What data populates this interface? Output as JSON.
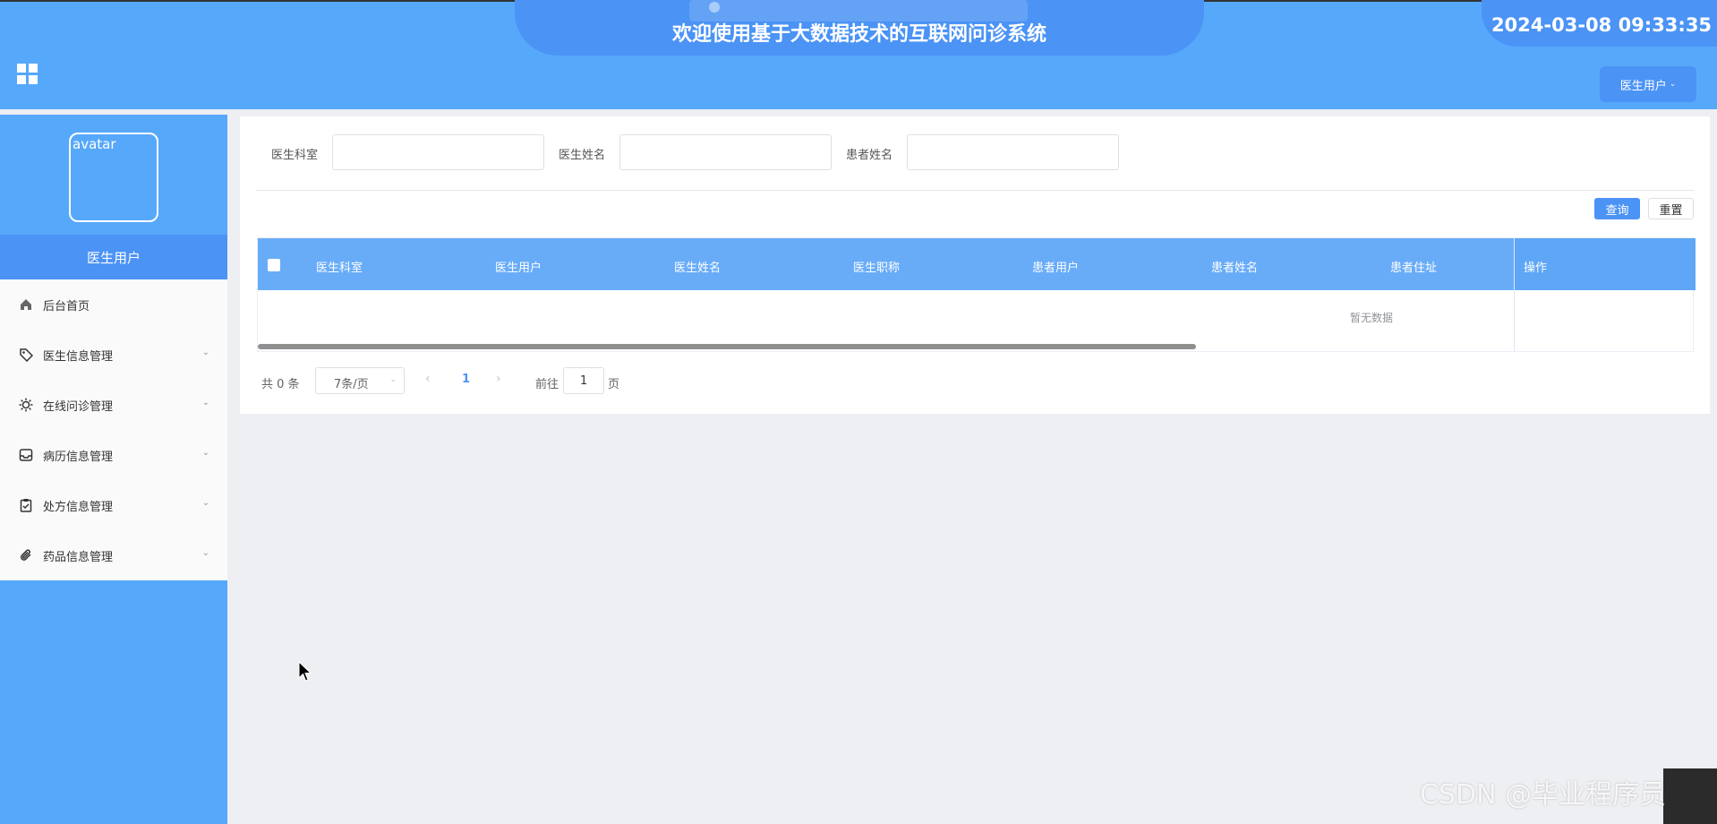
{
  "header": {
    "title": "欢迎使用基于大数据技术的互联网问诊系统",
    "datetime": "2024-03-08 09:33:35",
    "user_menu_label": "医生用户",
    "menu_toggle_icon": "grid-icon"
  },
  "sidebar": {
    "avatar_alt": "avatar",
    "role_label": "医生用户",
    "items": [
      {
        "label": "后台首页",
        "icon": "home-icon"
      },
      {
        "label": "医生信息管理",
        "icon": "tag-icon"
      },
      {
        "label": "在线问诊管理",
        "icon": "sun-icon"
      },
      {
        "label": "病历信息管理",
        "icon": "inbox-icon"
      },
      {
        "label": "处方信息管理",
        "icon": "clipboard-check-icon"
      },
      {
        "label": "药品信息管理",
        "icon": "paperclip-icon"
      }
    ]
  },
  "filters": {
    "dept_label": "医生科室",
    "doctor_name_label": "医生姓名",
    "patient_name_label": "患者姓名",
    "dept_value": "",
    "doctor_name_value": "",
    "patient_name_value": ""
  },
  "actions": {
    "query_label": "查询",
    "reset_label": "重置"
  },
  "table": {
    "columns": [
      "医生科室",
      "医生用户",
      "医生姓名",
      "医生职称",
      "患者用户",
      "患者姓名",
      "患者住址",
      "操作"
    ],
    "empty_text": "暂无数据"
  },
  "pagination": {
    "total_text": "共 0 条",
    "page_size": "7条/页",
    "current_page": "1",
    "goto_label": "前往",
    "goto_value": "1",
    "page_unit": "页"
  },
  "watermark": "CSDN @毕业程序员",
  "colors": {
    "primary": "#56a8fb",
    "accent": "#4b93f5",
    "table_header": "#68acf8",
    "background": "#eeeff3"
  }
}
